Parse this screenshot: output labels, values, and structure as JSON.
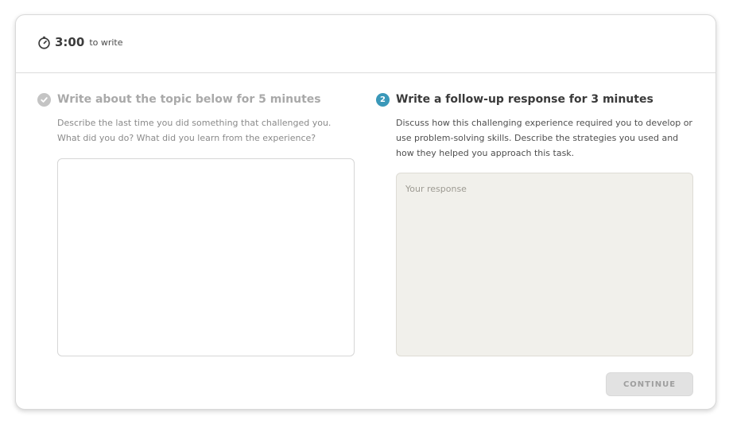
{
  "header": {
    "timer_value": "3:00",
    "timer_label": "to write",
    "timer_icon": "stopwatch-icon"
  },
  "step1": {
    "status": "completed",
    "icon": "checkmark-icon",
    "title": "Write about the topic below for 5 minutes",
    "prompt": "Describe the last time you did something that challenged you. What did you do? What did you learn from the experience?"
  },
  "step2": {
    "badge_number": "2",
    "title": "Write a follow-up response for 3 minutes",
    "prompt": "Discuss how this challenging experience required you to develop or use problem-solving skills. Describe the strategies you used and how they helped you approach this task.",
    "response_placeholder": "Your response",
    "response_value": ""
  },
  "actions": {
    "continue_label": "CONTINUE"
  },
  "colors": {
    "accent": "#3a98b9",
    "disabled_button_bg": "#e2e2e2",
    "active_textarea_bg": "#f1f0eb"
  }
}
